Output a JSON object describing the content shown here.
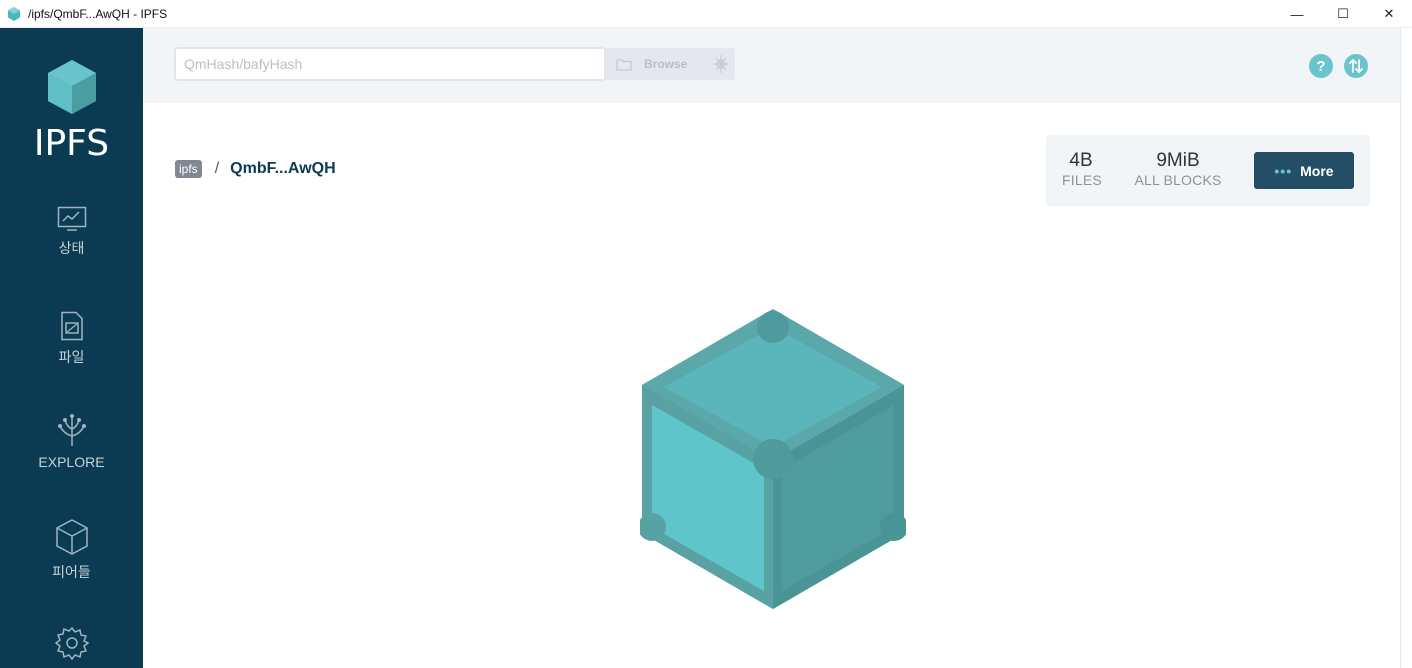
{
  "window": {
    "title": "/ipfs/QmbF...AwQH - IPFS",
    "minimize_label": "—",
    "maximize_label": "☐",
    "close_label": "✕"
  },
  "sidebar": {
    "logo_text": "IPFS",
    "items": [
      {
        "label": "상태",
        "icon": "status-chart-icon"
      },
      {
        "label": "파일",
        "icon": "files-icon"
      },
      {
        "label": "EXPLORE",
        "icon": "explore-tree-icon"
      },
      {
        "label": "피어들",
        "icon": "peers-cube-icon"
      },
      {
        "label": "",
        "icon": "settings-gear-icon"
      }
    ]
  },
  "header": {
    "search_placeholder": "QmHash/bafyHash",
    "browse_label": "Browse",
    "help_label": "?",
    "sync_icon": "transfer-arrows-icon"
  },
  "breadcrumb": {
    "root": "ipfs",
    "separator": "/",
    "current": "QmbF...AwQH"
  },
  "stats": {
    "files_value": "4B",
    "files_label": "FILES",
    "blocks_value": "9MiB",
    "blocks_label": "ALL BLOCKS",
    "more_dots": "•••",
    "more_label": "More"
  },
  "colors": {
    "sidebar_bg": "#0b3a53",
    "accent_teal": "#69c4cd",
    "more_button": "#244e66",
    "header_bg": "#f2f5f8"
  }
}
